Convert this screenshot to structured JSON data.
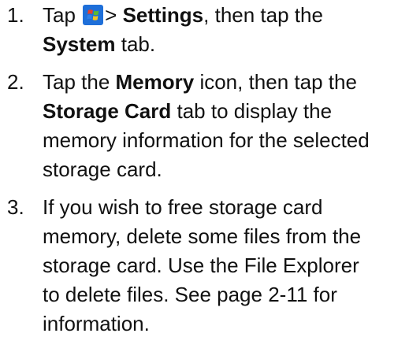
{
  "steps": [
    {
      "number": "1.",
      "line1": {
        "pre": "Tap",
        "gt": ">",
        "settings": "Settings",
        "post": ", then tap the"
      },
      "line2": {
        "system": "System",
        "post": " tab."
      },
      "icon": "windows-start-icon"
    },
    {
      "number": "2.",
      "line1": {
        "pre": "Tap the ",
        "memory": "Memory",
        "post": " icon, then tap the"
      },
      "line2": {
        "storage_card": "Storage Card",
        "post": " tab to display the"
      },
      "line3": "memory information for the selected",
      "line4": "storage card."
    },
    {
      "number": "3.",
      "lines": [
        "If you wish to free storage card",
        "memory, delete some files from the",
        "storage card. Use the File Explorer",
        "to delete files. See page 2-11 for",
        "information."
      ]
    }
  ],
  "colors": {
    "text": "#111111",
    "icon_blue": "#1e6fd9",
    "flag_red": "#e8402a",
    "flag_green": "#5dbb2e",
    "flag_blue": "#2f7fe6",
    "flag_yellow": "#f7c51e"
  }
}
